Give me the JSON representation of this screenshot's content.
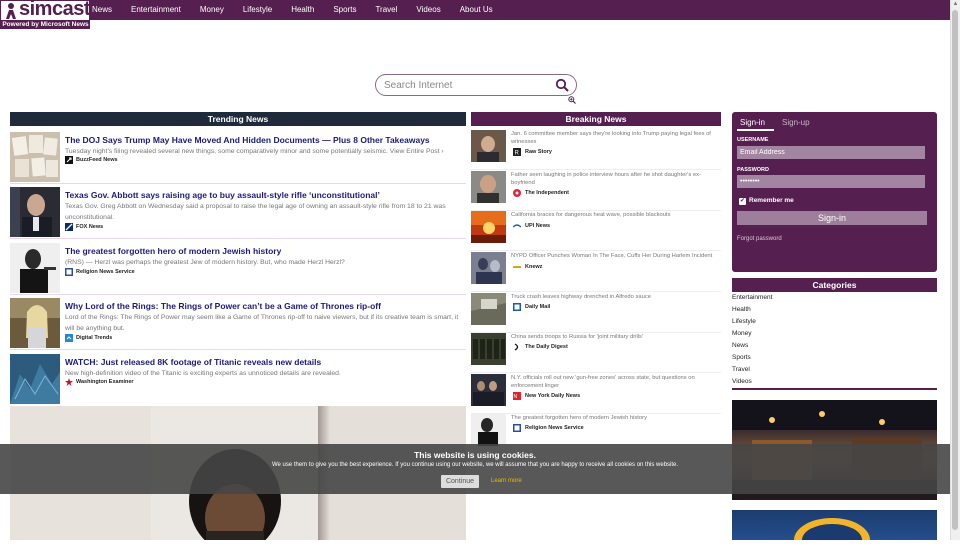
{
  "brand": {
    "name": "simcast",
    "tagline": "Powered by Microsoft News"
  },
  "nav": [
    "News",
    "Entertainment",
    "Money",
    "Lifestyle",
    "Health",
    "Sports",
    "Travel",
    "Videos",
    "About Us"
  ],
  "search": {
    "placeholder": "Search Internet"
  },
  "trending": {
    "heading": "Trending News",
    "items": [
      {
        "title": "The DOJ Says Trump May Have Moved And Hidden Documents — Plus 8 Other Takeaways",
        "desc": "Tuesday night's filing revealed several new things, some comparatively minor and some potentially seismic. View Entire Post ›",
        "source": "BuzzFeed News"
      },
      {
        "title": "Texas Gov. Abbott says raising age to buy assault-style rifle ‘unconstitutional’",
        "desc": "Texas Gov. Greg Abbott on Wednesday said a proposal to raise the legal age of owning an assault-style rifle from 18 to 21 was unconstitutional.",
        "source": "FOX News"
      },
      {
        "title": "The greatest forgotten hero of modern Jewish history",
        "desc": "(RNS) — Herzl was perhaps the greatest Jew of modern history. But, who made Herzl Herzl?",
        "source": "Religion News Service"
      },
      {
        "title": "Why Lord of the Rings: The Rings of Power can’t be a Game of Thrones rip-off",
        "desc": "Lord of the Rings: The Rings of Power may seem like a Game of Thrones rip-off to naive viewers, but if its creative team is smart, it will be anything but.",
        "source": "Digital Trends"
      },
      {
        "title": "WATCH: Just released 8K footage of Titanic reveals new details",
        "desc": "New high-definition video of the Titanic is exciting experts as unnoticed details are revealed.",
        "source": "Washington Examiner"
      }
    ]
  },
  "breaking": {
    "heading": "Breaking News",
    "items": [
      {
        "title": "Jan. 6 committee member says they're looking into Trump paying legal fees of witnesses",
        "source": "Raw Story"
      },
      {
        "title": "Father seen laughing in police interview hours after he shot daughter's ex-boyfriend",
        "source": "The Independent"
      },
      {
        "title": "California braces for dangerous heat wave, possible blackouts",
        "source": "UPI News"
      },
      {
        "title": "NYPD Officer Punches Woman In The Face, Cuffs Her During Harlem Incident",
        "source": "Knewz"
      },
      {
        "title": "Truck crash leaves highway drenched in Alfredo sauce",
        "source": "Daily Mail"
      },
      {
        "title": "China sends troops to Russia for 'joint military drills'",
        "source": "The Daily Digest"
      },
      {
        "title": "N.Y. officials roll out new 'gun-free zones' across state, but questions on enforcement linger",
        "source": "New York Daily News"
      },
      {
        "title": "The greatest forgotten hero of modern Jewish history",
        "source": "Religion News Service"
      }
    ]
  },
  "signin": {
    "tab_signin": "Sign-in",
    "tab_signup": "Sign-up",
    "username_label": "USERNAME",
    "username_placeholder": "Email Address",
    "password_label": "PASSWORD",
    "password_value": "••••••••",
    "remember_label": "Remember me",
    "button": "Sign-in",
    "forgot": "Forgot password"
  },
  "categories": {
    "heading": "Categories",
    "items": [
      "Entertainment",
      "Health",
      "Lifestyle",
      "Money",
      "News",
      "Sports",
      "Travel",
      "Videos"
    ]
  },
  "cookie": {
    "title": "This website is using cookies.",
    "text": "We use them to give you the best experience. If you continue using our website, we will assume that you are happy to receive all cookies on this website.",
    "button": "Continue",
    "learn": "Learn more"
  },
  "colors": {
    "brand": "#55204f",
    "trending_head": "#1f2b3a",
    "title_link": "#1b1b7a",
    "learn_more": "#f0b800"
  }
}
